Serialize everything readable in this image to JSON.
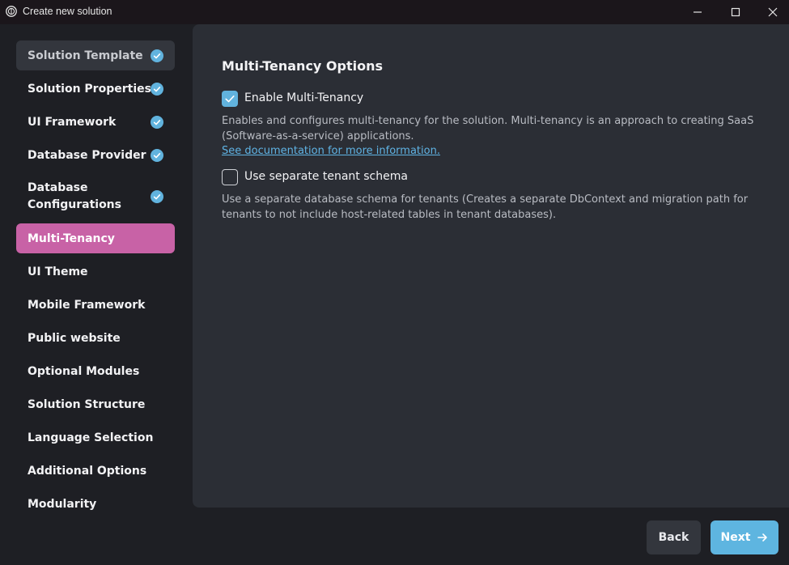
{
  "window": {
    "title": "Create new solution",
    "icon": "abp-logo-icon"
  },
  "sidebar": {
    "items": [
      {
        "label": "Solution Template",
        "state": "completed-selected"
      },
      {
        "label": "Solution Properties",
        "state": "completed"
      },
      {
        "label": "UI Framework",
        "state": "completed"
      },
      {
        "label": "Database Provider",
        "state": "completed"
      },
      {
        "label": "Database\nConfigurations",
        "state": "completed"
      },
      {
        "label": "Multi-Tenancy",
        "state": "active"
      },
      {
        "label": "UI Theme",
        "state": "pending"
      },
      {
        "label": "Mobile Framework",
        "state": "pending"
      },
      {
        "label": "Public website",
        "state": "pending"
      },
      {
        "label": "Optional Modules",
        "state": "pending"
      },
      {
        "label": "Solution Structure",
        "state": "pending"
      },
      {
        "label": "Language Selection",
        "state": "pending"
      },
      {
        "label": "Additional Options",
        "state": "pending"
      },
      {
        "label": "Modularity",
        "state": "pending"
      }
    ]
  },
  "main": {
    "title": "Multi-Tenancy Options",
    "enable_multitenancy": {
      "label": "Enable Multi-Tenancy",
      "checked": true,
      "description": "Enables and configures multi-tenancy for the solution. Multi-tenancy is an approach to creating SaaS (Software-as-a-service) applications.",
      "link": "See documentation for more information."
    },
    "separate_schema": {
      "label": "Use separate tenant schema",
      "checked": false,
      "description": "Use a separate database schema for tenants (Creates a separate DbContext and migration path for tenants to not include host-related tables in tenant databases)."
    }
  },
  "footer": {
    "back_label": "Back",
    "next_label": "Next"
  },
  "colors": {
    "active_item": "#c862a6",
    "check_badge": "#61b3de",
    "link": "#5fb3e4",
    "next_button": "#5eb5e0"
  }
}
